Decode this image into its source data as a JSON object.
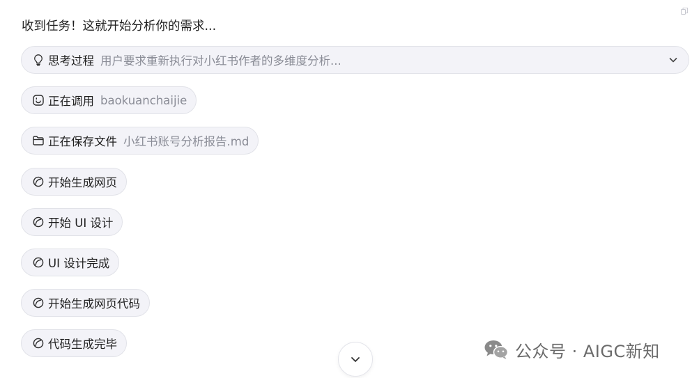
{
  "message": {
    "intro": "收到任务！这就开始分析你的需求..."
  },
  "thinking": {
    "label": "思考过程",
    "summary": "用户要求重新执行对小红书作者的多维度分析..."
  },
  "steps": [
    {
      "label": "正在调用",
      "detail": "baokuanchaijie",
      "icon": "tool-icon"
    },
    {
      "label": "正在保存文件",
      "detail": "小红书账号分析报告.md",
      "icon": "folder-icon"
    },
    {
      "label": "开始生成网页",
      "icon": "spinner-icon"
    },
    {
      "label": "开始 UI 设计",
      "icon": "spinner-icon"
    },
    {
      "label": "UI 设计完成",
      "icon": "spinner-icon"
    },
    {
      "label": "开始生成网页代码",
      "icon": "spinner-icon"
    },
    {
      "label": "代码生成完毕",
      "icon": "spinner-icon"
    }
  ],
  "watermark": {
    "text": "公众号 · AIGC新知",
    "icon": "wechat-logo-icon"
  },
  "colors": {
    "pill_bg": "#f3f3f8",
    "pill_border": "#e1e2e8",
    "muted_text": "#8a8c96",
    "text": "#1f1f1f"
  }
}
